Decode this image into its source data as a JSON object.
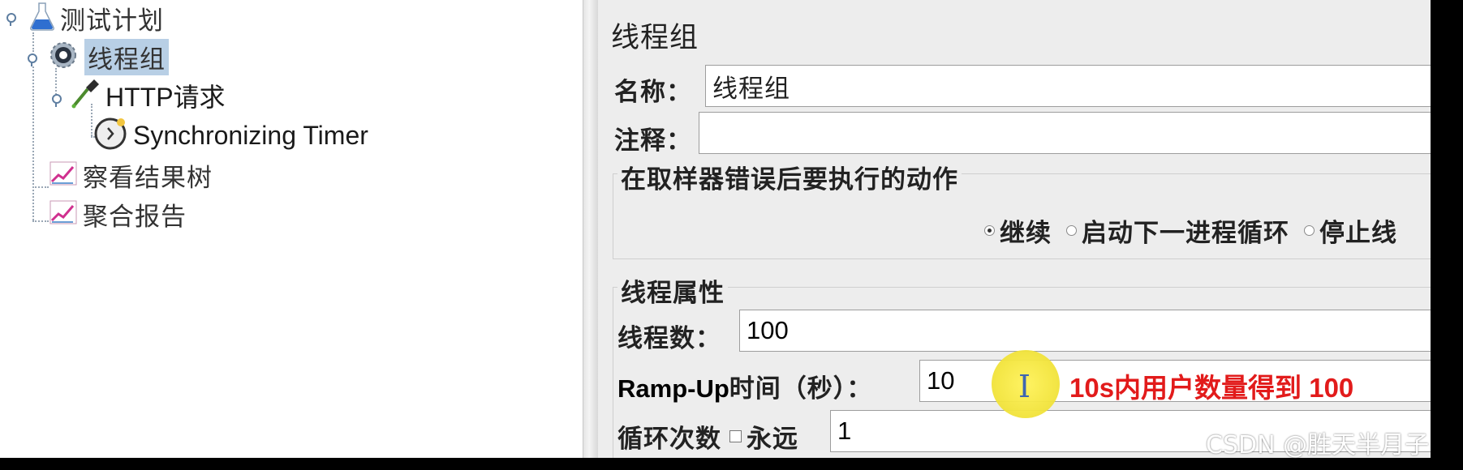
{
  "tree": {
    "test_plan": "测试计划",
    "thread_group": "线程组",
    "http_request": "HTTP请求",
    "sync_timer": "Synchronizing Timer",
    "view_results_tree": "察看结果树",
    "aggregate_report": "聚合报告"
  },
  "panel": {
    "title": "线程组",
    "name_label": "名称：",
    "name_value": "线程组",
    "comment_label": "注释：",
    "comment_value": "",
    "error_group_legend": "在取样器错误后要执行的动作",
    "error_actions": [
      {
        "label": "继续",
        "selected": true
      },
      {
        "label": "启动下一进程循环",
        "selected": false
      },
      {
        "label": "停止线",
        "selected": false
      }
    ],
    "thread_props_legend": "线程属性",
    "threads_label": "线程数：",
    "threads_value": "100",
    "rampup_label_latin": "Ramp-Up",
    "rampup_label_cn": "时间（秒）：",
    "rampup_value": "10",
    "loop_label": "循环次数",
    "forever_label": "永远",
    "loop_value": "1"
  },
  "overlay": {
    "annotation": "10s内用户数量得到 100",
    "annotation_color": "#e21b1b",
    "watermark": "CSDN @胜天半月子"
  },
  "colors": {
    "selection": "#b8cfe5",
    "panel_bg": "#ededed"
  }
}
